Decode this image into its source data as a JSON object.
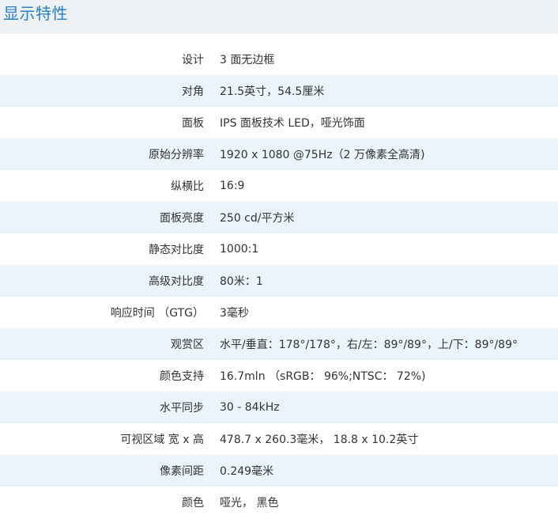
{
  "header": {
    "title": "显示特性"
  },
  "specs": [
    {
      "label": "设计",
      "value": "3 面无边框"
    },
    {
      "label": "对角",
      "value": "21.5英寸，54.5厘米"
    },
    {
      "label": "面板",
      "value": "IPS 面板技术 LED，哑光饰面"
    },
    {
      "label": "原始分辨率",
      "value": "1920 x 1080 @75Hz（2 万像素全高清)"
    },
    {
      "label": "纵横比",
      "value": "16:9"
    },
    {
      "label": "面板亮度",
      "value": "250 cd/平方米"
    },
    {
      "label": "静态对比度",
      "value": "1000:1"
    },
    {
      "label": "高级对比度",
      "value": "80米：1"
    },
    {
      "label": "响应时间 （GTG）",
      "value": "3毫秒"
    },
    {
      "label": "观赏区",
      "value": "水平/垂直：178°/178°，右/左：89°/89°，上/下：89°/89°"
    },
    {
      "label": "颜色支持",
      "value": "16.7mln （sRGB： 96%;NTSC： 72%)"
    },
    {
      "label": "水平同步",
      "value": "30 - 84kHz"
    },
    {
      "label": "可视区域 宽 x 高",
      "value": "478.7 x 260.3毫米， 18.8 x 10.2英寸"
    },
    {
      "label": "像素间距",
      "value": "0.249毫米"
    },
    {
      "label": "颜色",
      "value": "哑光， 黑色"
    }
  ],
  "colors": {
    "title": "#2a7fc4",
    "header_bg": "#eef1f4",
    "stripe_bg": "#eaf4fb",
    "text": "#333333"
  }
}
